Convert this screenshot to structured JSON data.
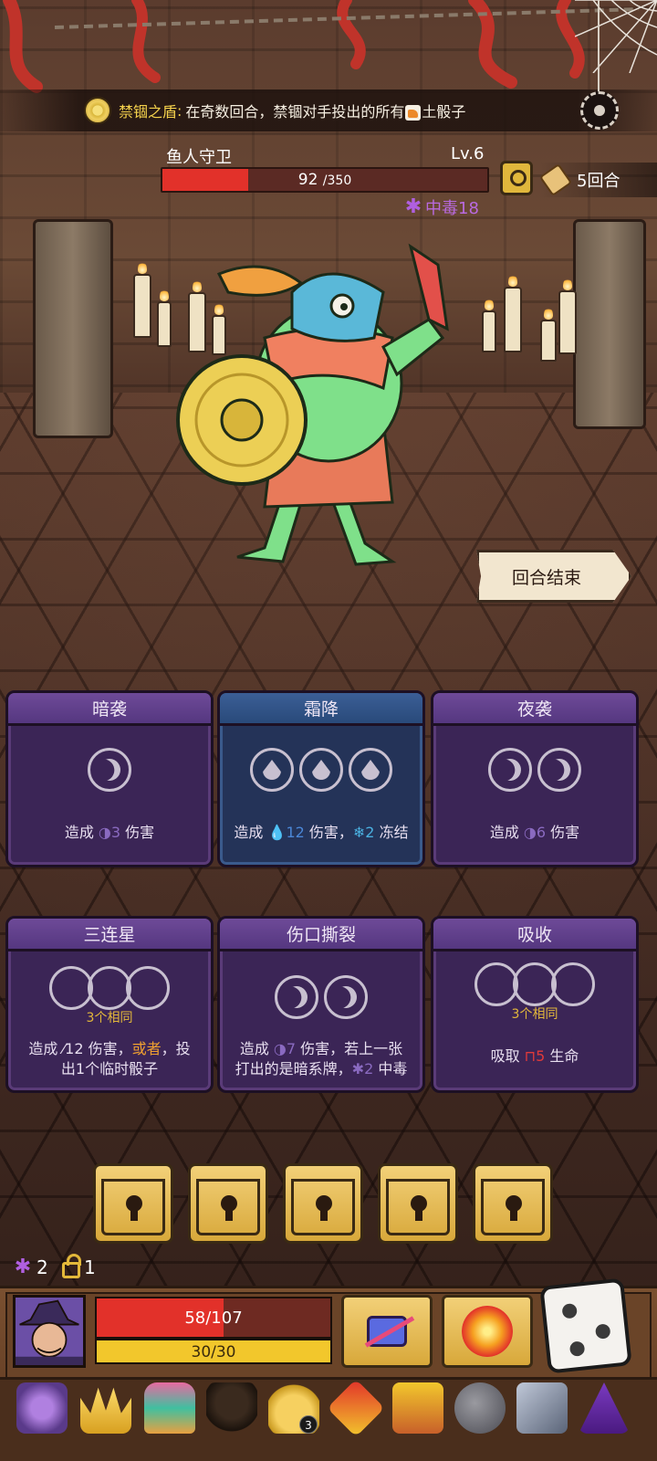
{
  "banner": {
    "relic_name": "禁锢之盾",
    "colon": ":",
    "text_before": "在奇数回合，禁锢对手投出的所有",
    "text_after": "土骰子",
    "coin_icon": "gold-coin-icon"
  },
  "enemy": {
    "name": "鱼人守卫",
    "level": "Lv.6",
    "hp_current": "92",
    "hp_max": "/350",
    "hp_fraction": 0.263,
    "poison_label": "中毒18",
    "round_label": "5回合"
  },
  "end_turn_label": "回合结束",
  "cards": [
    {
      "title": "暗袭",
      "style": "purple",
      "slots": [
        "moon"
      ],
      "desc_a": "造成 ",
      "desc_icon": "◑",
      "desc_val": "3",
      "desc_b": " 伤害"
    },
    {
      "title": "霜降",
      "style": "blue",
      "slots": [
        "drop",
        "drop",
        "drop"
      ],
      "desc_a": "造成 ",
      "desc_icon": "💧",
      "desc_val": "12",
      "desc_b": " 伤害，",
      "desc_icon2": "❄",
      "desc_val2": "2",
      "desc_c": " 冻结"
    },
    {
      "title": "夜袭",
      "style": "purple",
      "slots": [
        "moon",
        "moon"
      ],
      "desc_a": "造成 ",
      "desc_icon": "◑",
      "desc_val": "6",
      "desc_b": " 伤害"
    },
    {
      "title": "三连星",
      "style": "purple",
      "same": "3个相同",
      "desc_line1_a": "造成 ",
      "desc_line1_val": "12",
      "desc_line1_b": " 伤害，",
      "desc_line1_or": "或者",
      "desc_line1_c": "，投",
      "desc_line2": "出1个临时骰子"
    },
    {
      "title": "伤口撕裂",
      "style": "purple",
      "slots": [
        "moon",
        "moon"
      ],
      "desc_line1_a": "造成 ",
      "desc_line1_val": "7",
      "desc_line1_b": " 伤害，若上一张",
      "desc_line2_a": "打出的是暗系牌，",
      "desc_line2_val": "2",
      "desc_line2_b": " 中毒"
    },
    {
      "title": "吸收",
      "style": "purple",
      "same": "3个相同",
      "desc_a": "吸取 ",
      "desc_val": "5",
      "desc_b": " 生命"
    }
  ],
  "locked_slots": 5,
  "player": {
    "poison_count": "2",
    "lock_count": "1",
    "hp_text": "58/107",
    "hp_fraction": 0.542,
    "energy_text": "30/30",
    "energy_fraction": 1.0
  },
  "relics": [
    {
      "name": "skull-book-icon"
    },
    {
      "name": "golden-crown-icon"
    },
    {
      "name": "tiki-totem-icon"
    },
    {
      "name": "pirate-hat-icon"
    },
    {
      "name": "money-bag-icon",
      "badge": "3"
    },
    {
      "name": "rune-talisman-icon"
    },
    {
      "name": "dice-chest-icon"
    },
    {
      "name": "stone-orb-icon"
    },
    {
      "name": "metal-cube-icon"
    },
    {
      "name": "eye-flask-icon"
    }
  ],
  "colors": {
    "hp_red": "#e2312a",
    "energy_yellow": "#f2c72c",
    "poison_purple": "#b96ae0",
    "card_purple": "#3b2556",
    "card_blue": "#243358",
    "gold": "#e3b83a"
  }
}
